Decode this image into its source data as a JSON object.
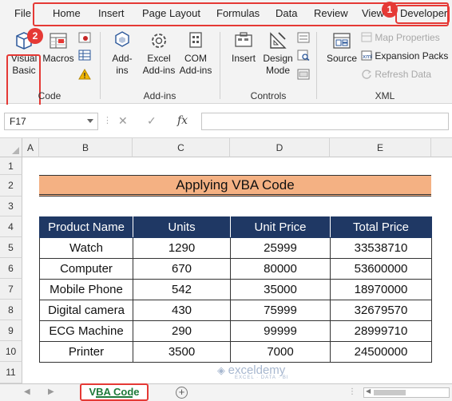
{
  "ribbon": {
    "tabs": [
      "File",
      "Home",
      "Insert",
      "Page Layout",
      "Formulas",
      "Data",
      "Review",
      "View",
      "Developer"
    ],
    "badges": {
      "one": "1",
      "two": "2"
    },
    "code_group": {
      "label": "Code",
      "visual_basic": [
        "Visual",
        "Basic"
      ],
      "macros": "Macros"
    },
    "addins_group": {
      "label": "Add-ins",
      "addins": [
        "Add-",
        "ins"
      ],
      "excel_addins": [
        "Excel",
        "Add-ins"
      ],
      "com_addins": [
        "COM",
        "Add-ins"
      ]
    },
    "controls_group": {
      "label": "Controls",
      "insert": "Insert",
      "design_mode": [
        "Design",
        "Mode"
      ]
    },
    "xml_group": {
      "label": "XML",
      "source": "Source",
      "map_properties": "Map Properties",
      "expansion_packs": "Expansion Packs",
      "refresh_data": "Refresh Data"
    }
  },
  "formula_bar": {
    "name_box": "F17",
    "cancel_glyph": "✕",
    "enter_glyph": "✓",
    "fx_label": "fx",
    "formula": ""
  },
  "grid": {
    "columns": [
      "A",
      "B",
      "C",
      "D",
      "E"
    ],
    "rows": [
      "1",
      "2",
      "3",
      "4",
      "5",
      "6",
      "7",
      "8",
      "9",
      "10",
      "11"
    ]
  },
  "sheet": {
    "title": "Applying VBA Code",
    "headers": [
      "Product Name",
      "Units",
      "Unit Price",
      "Total Price"
    ],
    "rows": [
      [
        "Watch",
        "1290",
        "25999",
        "33538710"
      ],
      [
        "Computer",
        "670",
        "80000",
        "53600000"
      ],
      [
        "Mobile Phone",
        "542",
        "35000",
        "18970000"
      ],
      [
        "Digital camera",
        "430",
        "75999",
        "32679570"
      ],
      [
        "ECG Machine",
        "290",
        "99999",
        "28999710"
      ],
      [
        "Printer",
        "3500",
        "7000",
        "24500000"
      ]
    ]
  },
  "sheet_tabs": {
    "active": "VBA Code",
    "add_glyph": "+"
  },
  "watermark": {
    "brand": "exceldemy",
    "tagline": "EXCEL · DATA · BI"
  },
  "colors": {
    "accent_red": "#e53935",
    "header_navy": "#1f3864",
    "title_fill": "#f4b183",
    "sheet_green": "#1e7a3a"
  }
}
